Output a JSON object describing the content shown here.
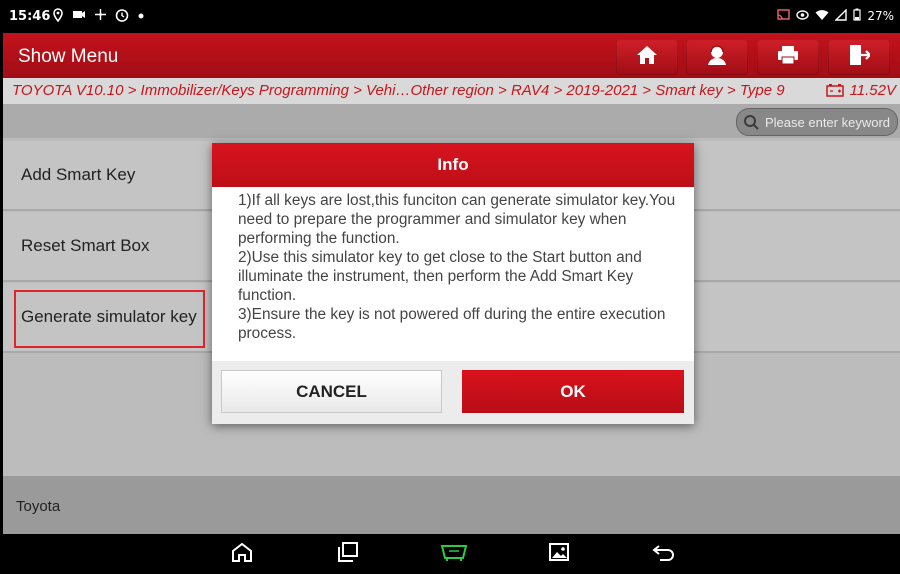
{
  "status_bar": {
    "time": "15:46",
    "battery": "27%",
    "left_icons": [
      "location-icon",
      "video-icon",
      "fan-icon",
      "timer-icon",
      "dot-icon"
    ],
    "right_icons": [
      "cast-icon",
      "eye-icon",
      "wifi-icon",
      "signal-icon",
      "battery-icon"
    ]
  },
  "header": {
    "title": "Show Menu",
    "buttons": [
      "home-icon",
      "user-support-icon",
      "print-icon",
      "exit-icon"
    ]
  },
  "breadcrumb": {
    "path": "TOYOTA V10.10 > Immobilizer/Keys Programming > Vehi…Other region > RAV4 > 2019-2021 > Smart key > Type 9",
    "voltage": "11.52V"
  },
  "search": {
    "placeholder": "Please enter keyword"
  },
  "menu": {
    "items": [
      {
        "label": "Add Smart Key"
      },
      {
        "label": "Reset Smart Box"
      },
      {
        "label": "Generate simulator key"
      }
    ]
  },
  "footer": {
    "label": "Toyota"
  },
  "dialog": {
    "title": "Info",
    "lines": [
      "1)If all keys are lost,this funciton can generate simulator key.You need to prepare the programmer and simulator key when performing the function.",
      "2)Use this simulator key to get close to the Start button and illuminate the instrument, then perform the Add Smart Key function.",
      "3)Ensure the key is not powered off during the entire execution process."
    ],
    "cancel_label": "CANCEL",
    "ok_label": "OK"
  },
  "nav_bar": [
    "home-icon",
    "recent-apps-icon",
    "vci-icon",
    "screenshot-icon",
    "back-icon"
  ],
  "colors": {
    "brand_red": "#c3121c",
    "vci_green": "#2ecc40"
  }
}
